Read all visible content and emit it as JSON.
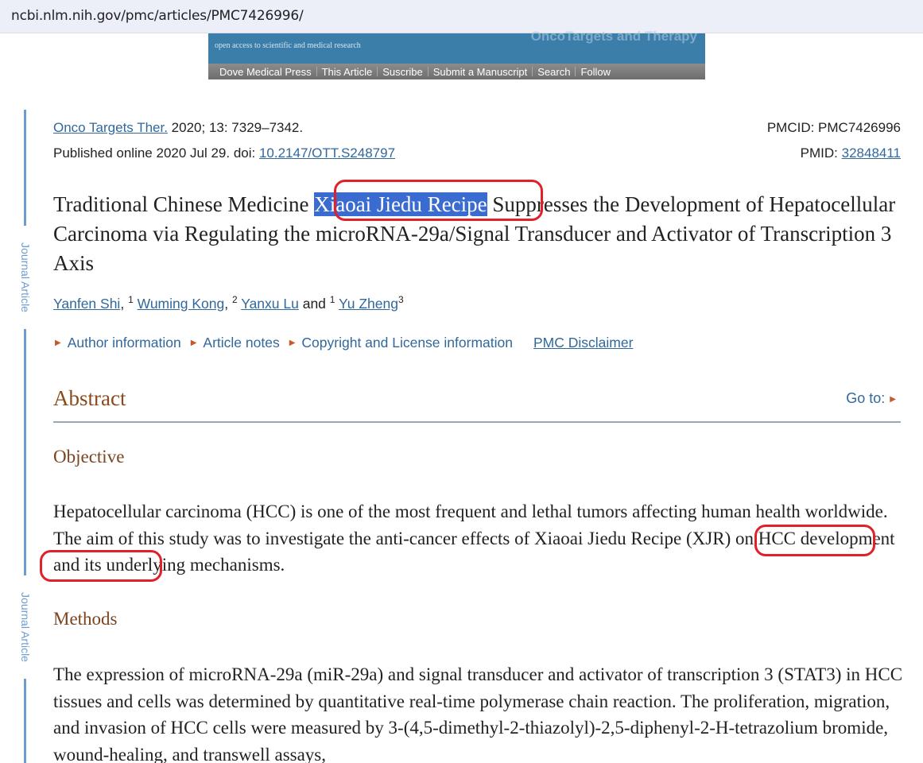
{
  "browser": {
    "url": "ncbi.nlm.nih.gov/pmc/articles/PMC7426996/"
  },
  "banner": {
    "brand": "OncoTargets and Therapy",
    "tagline": "open access to scientific and medical research",
    "nav": [
      "Dove Medical Press",
      "This Article",
      "Suscribe",
      "Submit a Manuscript",
      "Search",
      "Follow"
    ]
  },
  "sidebar": {
    "label": "Journal Article"
  },
  "citation": {
    "journal": "Onco Targets Ther.",
    "details": " 2020; 13: 7329–7342.",
    "published_prefix": "Published online 2020 Jul 29. doi: ",
    "doi": "10.2147/OTT.S248797",
    "pmcid": "PMCID: PMC7426996",
    "pmid_label": "PMID: ",
    "pmid": "32848411"
  },
  "article": {
    "title_before": "Traditional Chinese Medicine ",
    "title_highlight": "Xiaoai Jiedu Recipe",
    "title_after": " Suppresses the Development of Hepatocellular Carcinoma via Regulating the microRNA-29a/Signal Transducer and Activator of Transcription 3 Axis",
    "authors": [
      {
        "name": "Yanfen Shi",
        "sup": "1",
        "sep": ", "
      },
      {
        "name": "Wuming Kong",
        "sup": "2",
        "sep": ", "
      },
      {
        "name": "Yanxu Lu",
        "sup": "1",
        "sep": " and "
      },
      {
        "name": "Yu Zheng",
        "sup": "3",
        "sep": ""
      }
    ],
    "meta_links": [
      "Author information",
      "Article notes",
      "Copyright and License information"
    ],
    "disclaimer": "PMC Disclaimer"
  },
  "abstract": {
    "heading": "Abstract",
    "goto": "Go to:",
    "sections": [
      {
        "heading": "Objective",
        "text_1": "Hepatocellular carcinoma (HCC) is one of the most frequent and lethal tumors affecting human health worldwide. The aim of this study was to investigate the anti-cancer effects of ",
        "text_mark_a": "Xiaoai Jiedu",
        "text_mid": " ",
        "text_mark_b": "Recipe (XJR)",
        "text_2": " on HCC development and its underlying mechanisms."
      },
      {
        "heading": "Methods",
        "text": "The expression of microRNA-29a (miR-29a) and signal transducer and activator of transcription 3 (STAT3) in HCC tissues and cells was determined by quantitative real-time polymerase chain reaction. The proliferation, migration, and invasion of HCC cells were measured by 3-(4,5-dimethyl-2-thiazolyl)-2,5-diphenyl-2-H-tetrazolium bromide, wound-healing, and transwell assays,"
      }
    ]
  }
}
